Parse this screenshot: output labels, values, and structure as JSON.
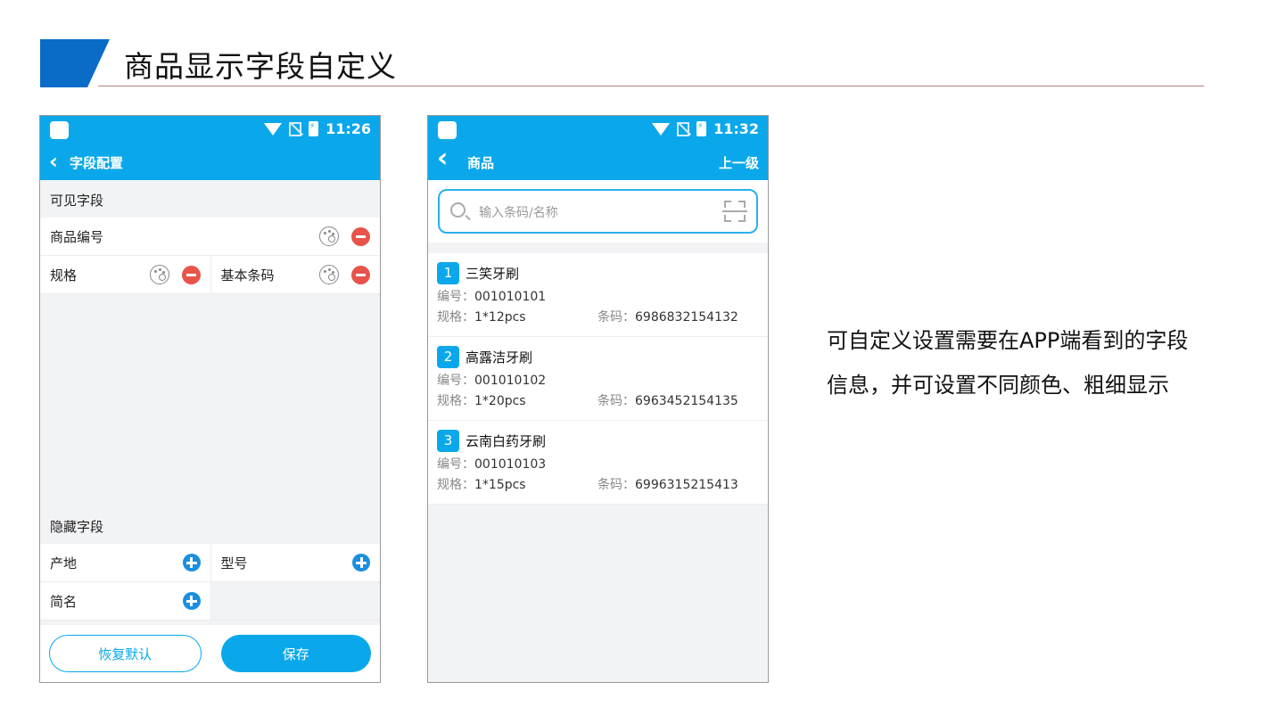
{
  "slide": {
    "title": "商品显示字段自定义",
    "description_lines": [
      "可自定义设置需要在APP端看到的字段",
      "信息，并可设置不同颜色、粗细显示"
    ],
    "accent_color": "#0b6cc8"
  },
  "phone1": {
    "status_time": "11:26",
    "back_icon": "‹",
    "title": "字段配置",
    "visible_label": "可见字段",
    "visible_fields": [
      "商品编号",
      "规格",
      "基本条码"
    ],
    "hidden_label": "隐藏字段",
    "hidden_fields": [
      "产地",
      "型号",
      "简名"
    ],
    "reset_button": "恢复默认",
    "save_button": "保存"
  },
  "phone2": {
    "status_time": "11:32",
    "back_icon": "‹",
    "title": "商品",
    "right_action": "上一级",
    "search_placeholder": "输入条码/名称",
    "code_key": "编号：",
    "spec_key": "规格：",
    "barcode_key": "条码：",
    "items": [
      {
        "index": "1",
        "name": "三笑牙刷",
        "code": "001010101",
        "spec": "1*12pcs",
        "barcode": "6986832154132"
      },
      {
        "index": "2",
        "name": "高露洁牙刷",
        "code": "001010102",
        "spec": "1*20pcs",
        "barcode": "6963452154135"
      },
      {
        "index": "3",
        "name": "云南白药牙刷",
        "code": "001010103",
        "spec": "1*15pcs",
        "barcode": "6996315215413"
      }
    ]
  },
  "colors": {
    "app_blue": "#0aa8ea",
    "remove_red": "#e8534a",
    "add_blue": "#1a8fe0"
  }
}
